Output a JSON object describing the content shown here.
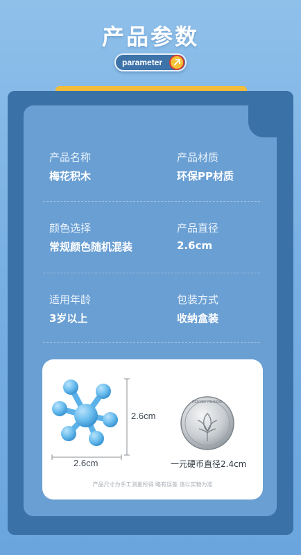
{
  "header": {
    "title": "产品参数",
    "badge_label": "parameter",
    "badge_icon": "arrow-up-right-icon"
  },
  "colors": {
    "background": "#79b0e3",
    "card_dark": "#3a72a8",
    "card_light": "#6a9fd3",
    "accent_yellow": "#f3bd3a",
    "accent_red": "#d64032"
  },
  "specs": [
    {
      "label": "产品名称",
      "value": "梅花积木"
    },
    {
      "label": "产品材质",
      "value": "环保PP材质"
    },
    {
      "label": "颜色选择",
      "value": "常规颜色随机混装"
    },
    {
      "label": "产品直径",
      "value": "2.6cm"
    },
    {
      "label": "适用年龄",
      "value": "3岁以上"
    },
    {
      "label": "包装方式",
      "value": "收纳盒装"
    }
  ],
  "photo": {
    "width_label": "2.6cm",
    "height_label": "2.6cm",
    "coin_caption": "一元硬币直径2.4cm",
    "coin_text": "RENMIN YINHANG",
    "disclaimer": "产品尺寸为手工测量所得  略有误差  请以实物为准"
  }
}
